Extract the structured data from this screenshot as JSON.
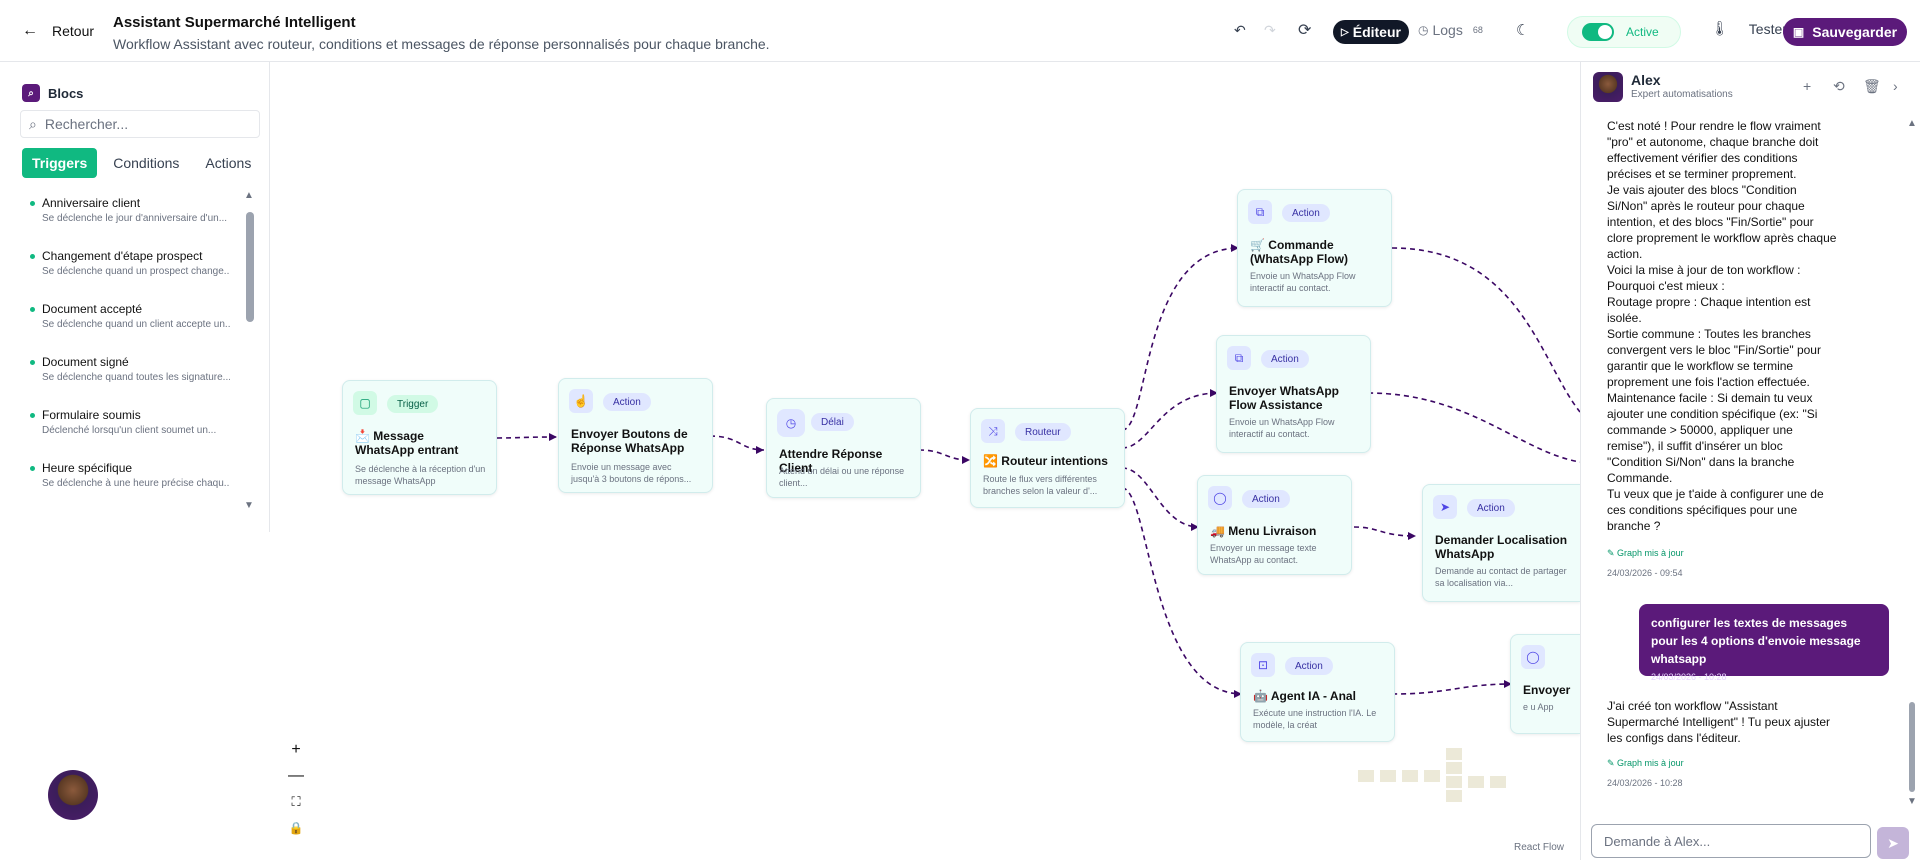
{
  "header": {
    "back_label": "Retour",
    "title": "Assistant Supermarché Intelligent",
    "subtitle": "Workflow Assistant avec routeur, conditions et messages de réponse personnalisés pour chaque branche.",
    "editor_label": "Éditeur",
    "logs_label": "Logs",
    "logs_count": "68",
    "active_label": "Active",
    "test_label": "Tester",
    "save_label": "Sauvegarder"
  },
  "sidebar": {
    "title": "Blocs",
    "search_placeholder": "Rechercher...",
    "tabs": [
      "Triggers",
      "Conditions",
      "Actions"
    ],
    "items": [
      {
        "name": "Anniversaire client",
        "desc": "Se déclenche le jour d'anniversaire d'un..."
      },
      {
        "name": "Changement d'étape prospect",
        "desc": "Se déclenche quand un prospect change..."
      },
      {
        "name": "Document accepté",
        "desc": "Se déclenche quand un client accepte un..."
      },
      {
        "name": "Document signé",
        "desc": "Se déclenche quand toutes les signature..."
      },
      {
        "name": "Formulaire soumis",
        "desc": "Déclenché lorsqu'un client soumet un..."
      },
      {
        "name": "Heure spécifique",
        "desc": "Se déclenche à une heure précise chaqu..."
      }
    ]
  },
  "nodes": [
    {
      "tag": "Trigger",
      "title": "📩 Message WhatsApp entrant",
      "desc": "Se déclenche à la réception d'un message WhatsApp"
    },
    {
      "tag": "Action",
      "title": "Envoyer Boutons de Réponse WhatsApp",
      "desc": "Envoie un message avec jusqu'à 3 boutons de répons..."
    },
    {
      "tag": "Délai",
      "title": "Attendre Réponse Client",
      "desc": "Attend un délai ou une réponse client..."
    },
    {
      "tag": "Routeur",
      "title": "🔀 Routeur intentions",
      "desc": "Route le flux vers différentes branches selon la valeur d'..."
    },
    {
      "tag": "Action",
      "title": "🛒 Commande (WhatsApp Flow)",
      "desc": "Envoie un WhatsApp Flow interactif au contact."
    },
    {
      "tag": "Action",
      "title": "Envoyer WhatsApp Flow Assistance",
      "desc": "Envoie un WhatsApp Flow interactif au contact."
    },
    {
      "tag": "Action",
      "title": "🚚 Menu Livraison",
      "desc": "Envoyer un message texte WhatsApp au contact."
    },
    {
      "tag": "Action",
      "title": "Demander Localisation WhatsApp",
      "desc": "Demande au contact de partager sa localisation via..."
    },
    {
      "tag": "Action",
      "title": "🤖 Agent IA - Anal",
      "desc": "Exécute une instruction l'IA. Le modèle, la créat"
    },
    {
      "tag": "",
      "title": "Envoyer",
      "desc": "e u App"
    }
  ],
  "canvas": {
    "brand": "React Flow"
  },
  "assistant": {
    "name": "Alex",
    "role": "Expert automatisations",
    "messages": [
      "C'est noté ! Pour rendre le flow vraiment \"pro\" et autonome, chaque branche doit effectivement vérifier des conditions précises et se terminer proprement.",
      "Je vais ajouter des blocs \"Condition Si/Non\" après le routeur pour chaque intention, et des blocs \"Fin/Sortie\" pour clore proprement le workflow après chaque action.",
      "Voici la mise à jour de ton workflow :",
      "Pourquoi c'est mieux :",
      "Routage propre : Chaque intention est isolée.",
      "Sortie commune : Toutes les branches convergent vers le bloc \"Fin/Sortie\" pour garantir que le workflow se termine proprement une fois l'action effectuée.",
      "Maintenance facile : Si demain tu veux ajouter une condition spécifique (ex: \"Si commande > 50000, appliquer une remise\"), il suffit d'insérer un bloc \"Condition Si/Non\" dans la branche Commande.",
      "Tu veux que je t'aide à configurer une de ces conditions spécifiques pour une branche ?"
    ],
    "graph_label_1": "Graph mis à jour",
    "ts_1": "24/03/2026 - 09:54",
    "user_msg": "configurer les textes de messages pour les 4 options d'envoie message whatsapp",
    "user_ts": "24/03/2026 - 10:28",
    "reply": "J'ai créé ton workflow \"Assistant Supermarché Intelligent\" ! Tu peux ajuster les configs dans l'éditeur.",
    "graph_label_2": "Graph mis à jour",
    "ts_2": "24/03/2026 - 10:28",
    "input_placeholder": "Demande à Alex..."
  },
  "colors": {
    "brand": "#5b1a7a",
    "active": "#10b981"
  }
}
